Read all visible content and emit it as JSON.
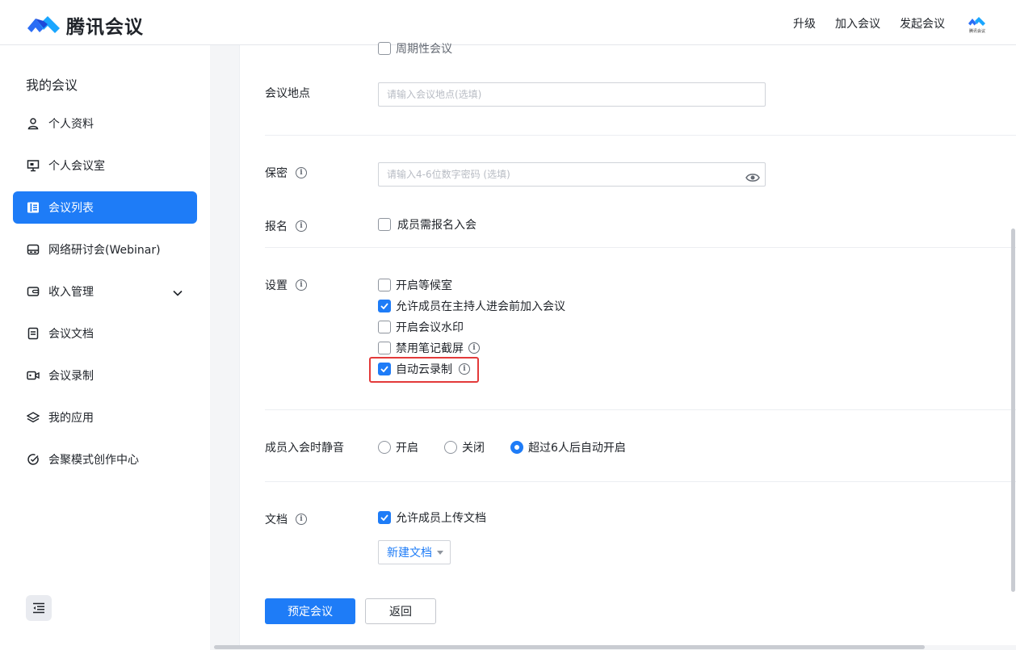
{
  "app": {
    "name": "腾讯会议",
    "avatar_caption": "腾讯会议"
  },
  "colors": {
    "accent": "#1e7cf7",
    "highlight": "#e33a3a"
  },
  "topnav": {
    "upgrade": "升级",
    "join": "加入会议",
    "start": "发起会议"
  },
  "sidebar": {
    "title": "我的会议",
    "items": [
      {
        "label": "个人资料",
        "icon": "user-icon"
      },
      {
        "label": "个人会议室",
        "icon": "monitor-icon"
      },
      {
        "label": "会议列表",
        "icon": "list-icon"
      },
      {
        "label": "网络研讨会(Webinar)",
        "icon": "webinar-icon"
      },
      {
        "label": "收入管理",
        "icon": "wallet-icon"
      },
      {
        "label": "会议文档",
        "icon": "document-icon"
      },
      {
        "label": "会议录制",
        "icon": "camera-icon"
      },
      {
        "label": "我的应用",
        "icon": "layers-icon"
      },
      {
        "label": "会聚模式创作中心",
        "icon": "creation-icon"
      }
    ]
  },
  "form": {
    "recurring_label": "周期性会议",
    "location": {
      "label": "会议地点",
      "placeholder": "请输入会议地点(选填)"
    },
    "password": {
      "label": "保密",
      "placeholder": "请输入4-6位数字密码 (选填)"
    },
    "registration": {
      "label": "报名",
      "option": "成员需报名入会"
    },
    "settings": {
      "label": "设置",
      "options": [
        {
          "label": "开启等候室",
          "checked": false
        },
        {
          "label": "允许成员在主持人进会前加入会议",
          "checked": true
        },
        {
          "label": "开启会议水印",
          "checked": false
        },
        {
          "label": "禁用笔记截屏",
          "checked": false
        },
        {
          "label": "自动云录制",
          "checked": true
        }
      ]
    },
    "mute": {
      "label": "成员入会时静音",
      "options": [
        {
          "label": "开启",
          "checked": false
        },
        {
          "label": "关闭",
          "checked": false
        },
        {
          "label": "超过6人后自动开启",
          "checked": true
        }
      ]
    },
    "docs": {
      "label": "文档",
      "option": "允许成员上传文档",
      "new_doc": "新建文档"
    }
  },
  "actions": {
    "submit": "预定会议",
    "back": "返回"
  }
}
